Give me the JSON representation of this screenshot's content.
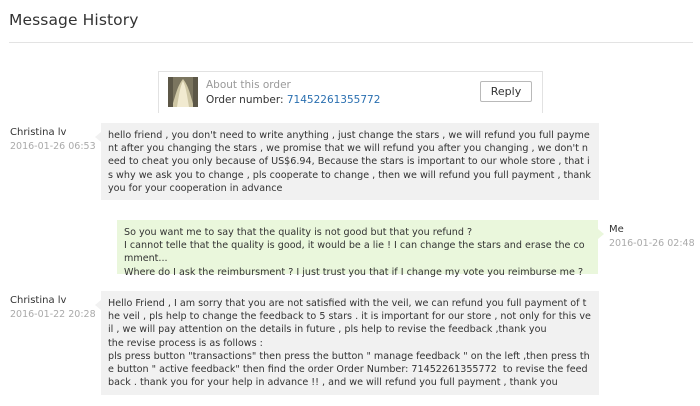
{
  "page": {
    "title": "Message History"
  },
  "order": {
    "about_label": "About this order",
    "number_label": "Order number:",
    "number_value": "71452261355772",
    "reply_label": "Reply"
  },
  "messages": [
    {
      "sender": "Christina lv",
      "date": "2016-01-26 06:53",
      "text": "hello friend , you don't need to write anything , just change the stars , we will refund you full payment after you changing the stars , we promise that we will refund you after you changing , we don't need to cheat you only because of US$6.94, Because the stars is important to our whole store , that is why we ask you to change , pls cooperate to change , then we will refund you full payment , thank you for your cooperation in advance"
    },
    {
      "sender": "Me",
      "date": "2016-01-26 02:48",
      "text": "So you want me to say that the quality is not good but that you refund ?\nI cannot telle that the quality is good, it would be a lie ! I can change the stars and erase the comment...\nWhere do I ask the reimbursment ? I just trust you that if I change my vote you reimburse me ?"
    },
    {
      "sender": "Christina lv",
      "date": "2016-01-22 20:28",
      "text": "Hello Friend , I am sorry that you are not satisfied with the veil, we can refund you full payment of the veil , pls help to change the feedback to 5 stars . it is important for our store , not only for this veil , we will pay attention on the details in future , pls help to revise the feedback ,thank you\nthe revise process is as follows :\npls press button \"transactions\" then press the button \" manage feedback \" on the left ,then press the button \" active feedback\" then find the order Order Number: 71452261355772  to revise the feedback . thank you for your help in advance !! , and we will refund you full payment , thank you"
    }
  ]
}
